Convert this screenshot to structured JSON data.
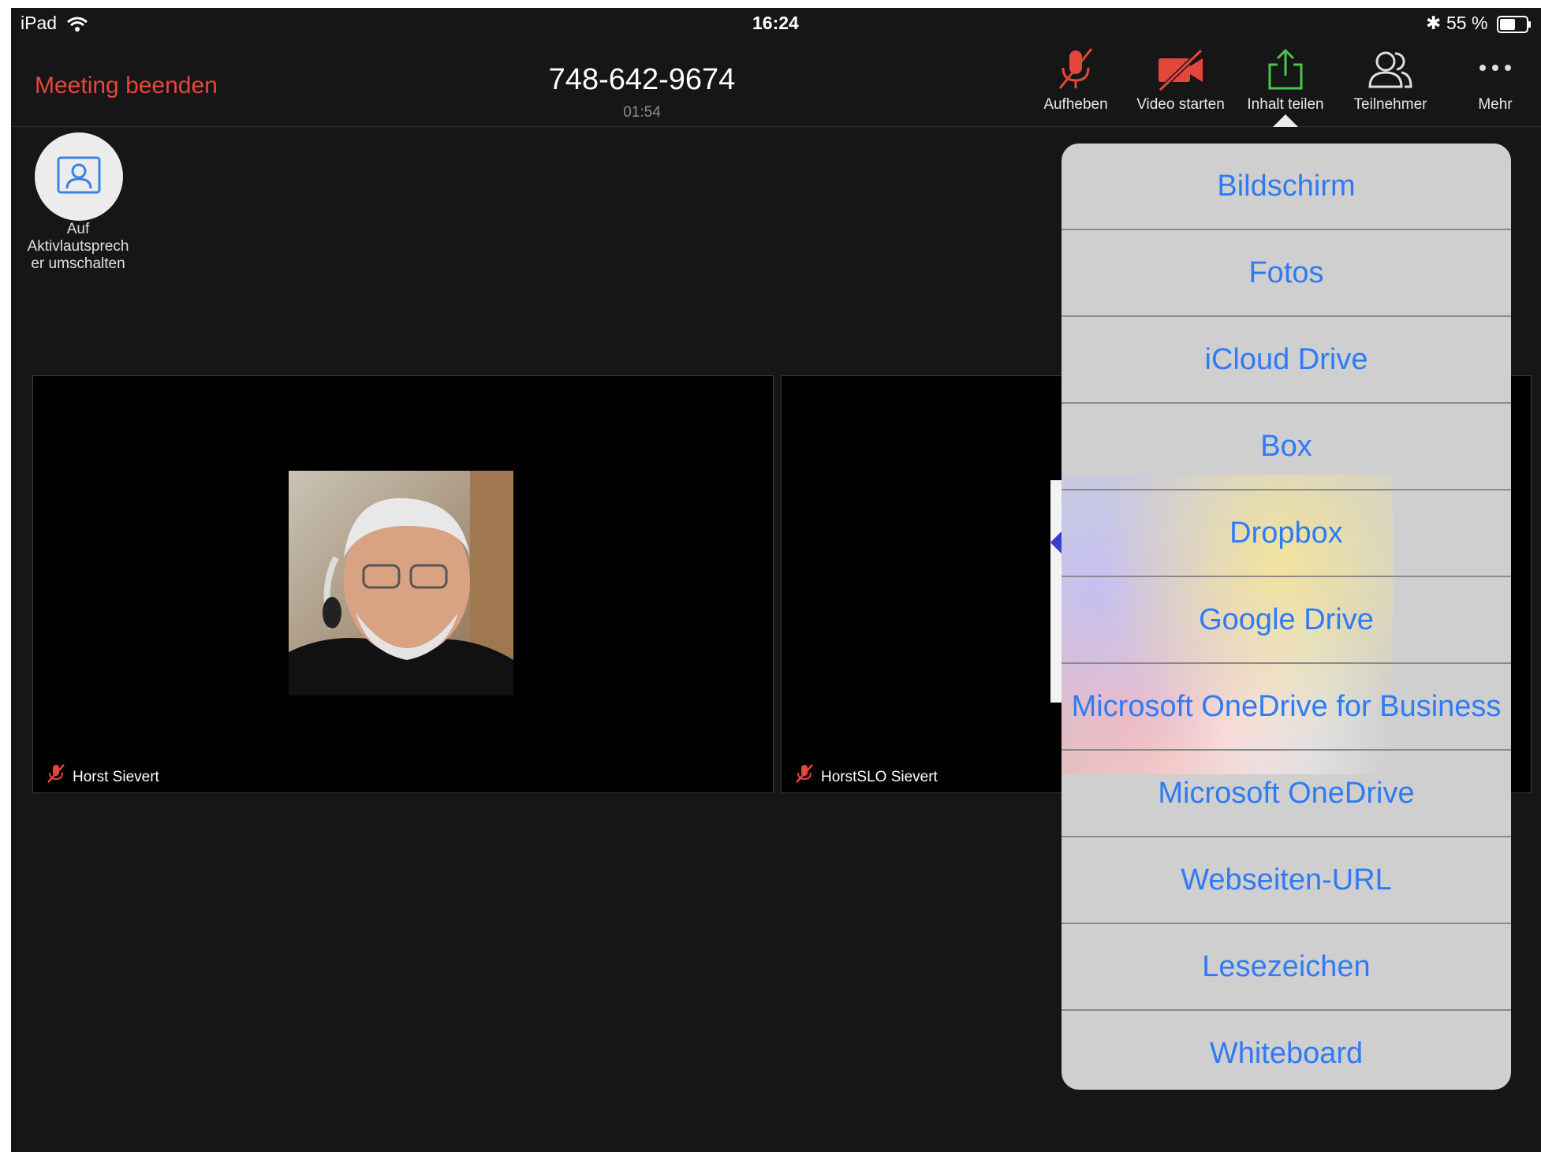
{
  "status_bar": {
    "device": "iPad",
    "time": "16:24",
    "battery": "55 %"
  },
  "meeting": {
    "end_label": "Meeting beenden",
    "meeting_id": "748-642-9674",
    "duration": "01:54"
  },
  "toolbar": [
    {
      "label": "Aufheben",
      "icon": "muted-mic-icon"
    },
    {
      "label": "Video starten",
      "icon": "video-off-icon"
    },
    {
      "label": "Inhalt teilen",
      "icon": "share-content-icon"
    },
    {
      "label": "Teilnehmer",
      "icon": "participants-icon"
    },
    {
      "label": "Mehr",
      "icon": "more-dots-icon"
    }
  ],
  "speaker_toggle": {
    "label": "Auf\nAktivlautsprech\ner umschalten"
  },
  "participants": [
    {
      "name": "Horst Sievert",
      "muted": true
    },
    {
      "name": "HorstSLO Sievert",
      "muted": true
    }
  ],
  "share_menu": {
    "items": [
      "Bildschirm",
      "Fotos",
      "iCloud Drive",
      "Box",
      "Dropbox",
      "Google Drive",
      "Microsoft OneDrive for Business",
      "Microsoft OneDrive",
      "Webseiten-URL",
      "Lesezeichen",
      "Whiteboard"
    ]
  },
  "colors": {
    "accent_red": "#e5463b",
    "share_green": "#4cc34c",
    "menu_text": "#2f7bf6",
    "background": "#161616"
  }
}
